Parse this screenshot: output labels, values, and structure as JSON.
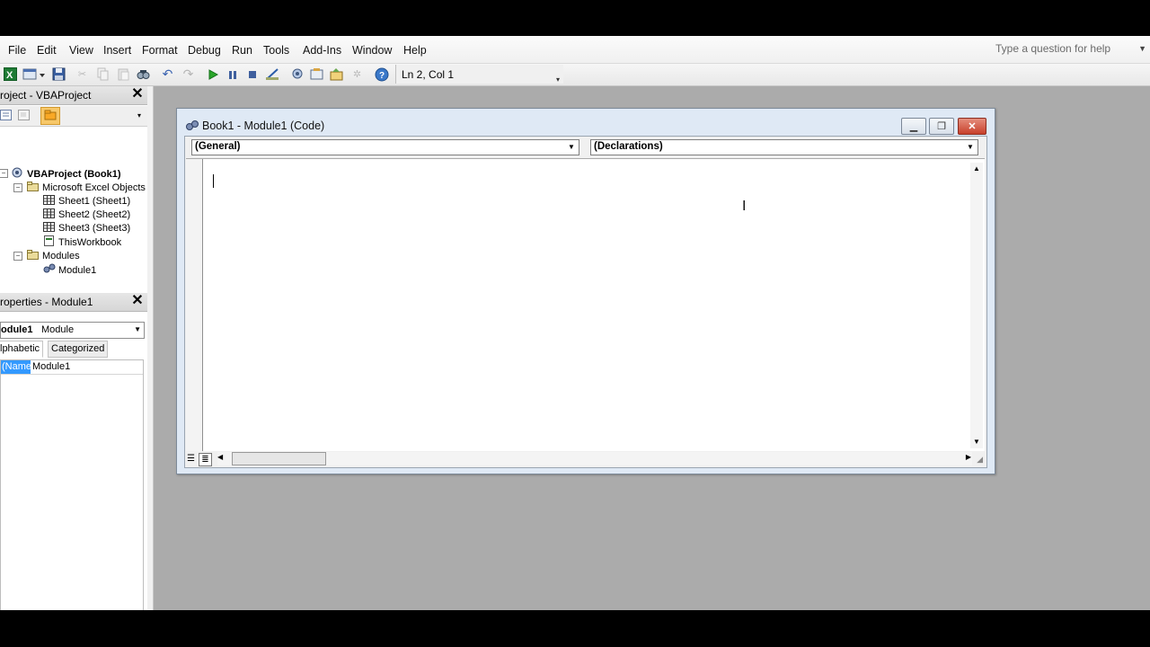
{
  "menu": {
    "items": [
      "File",
      "Edit",
      "View",
      "Insert",
      "Format",
      "Debug",
      "Run",
      "Tools",
      "Add-Ins",
      "Window",
      "Help"
    ],
    "help_placeholder": "Type a question for help"
  },
  "toolbar": {
    "position_label": "Ln 2, Col 1",
    "icons": [
      "excel-icon",
      "insert-userform-icon",
      "save-icon",
      "cut-icon",
      "copy-icon",
      "paste-icon",
      "find-icon",
      "undo-icon",
      "redo-icon",
      "run-icon",
      "break-icon",
      "reset-icon",
      "design-mode-icon",
      "project-explorer-icon",
      "properties-window-icon",
      "object-browser-icon",
      "toolbox-icon",
      "help-icon"
    ]
  },
  "project_panel": {
    "title": "roject - VBAProject",
    "root": "VBAProject (Book1)",
    "folder_objects": "Microsoft Excel Objects",
    "sheets": [
      "Sheet1 (Sheet1)",
      "Sheet2 (Sheet2)",
      "Sheet3 (Sheet3)"
    ],
    "workbook": "ThisWorkbook",
    "folder_modules": "Modules",
    "module": "Module1"
  },
  "properties_panel": {
    "title": "roperties - Module1",
    "object_name": "odule1",
    "object_type": "Module",
    "tab_alphabetic": "lphabetic",
    "tab_categorized": "Categorized",
    "prop_name": "(Name)",
    "prop_value": "Module1"
  },
  "code_window": {
    "title": "Book1 - Module1 (Code)",
    "object_combo": "(General)",
    "procedure_combo": "(Declarations)"
  },
  "colors": {
    "workspace": "#ababab",
    "selection": "#3399ff",
    "close_button": "#c8402b"
  }
}
